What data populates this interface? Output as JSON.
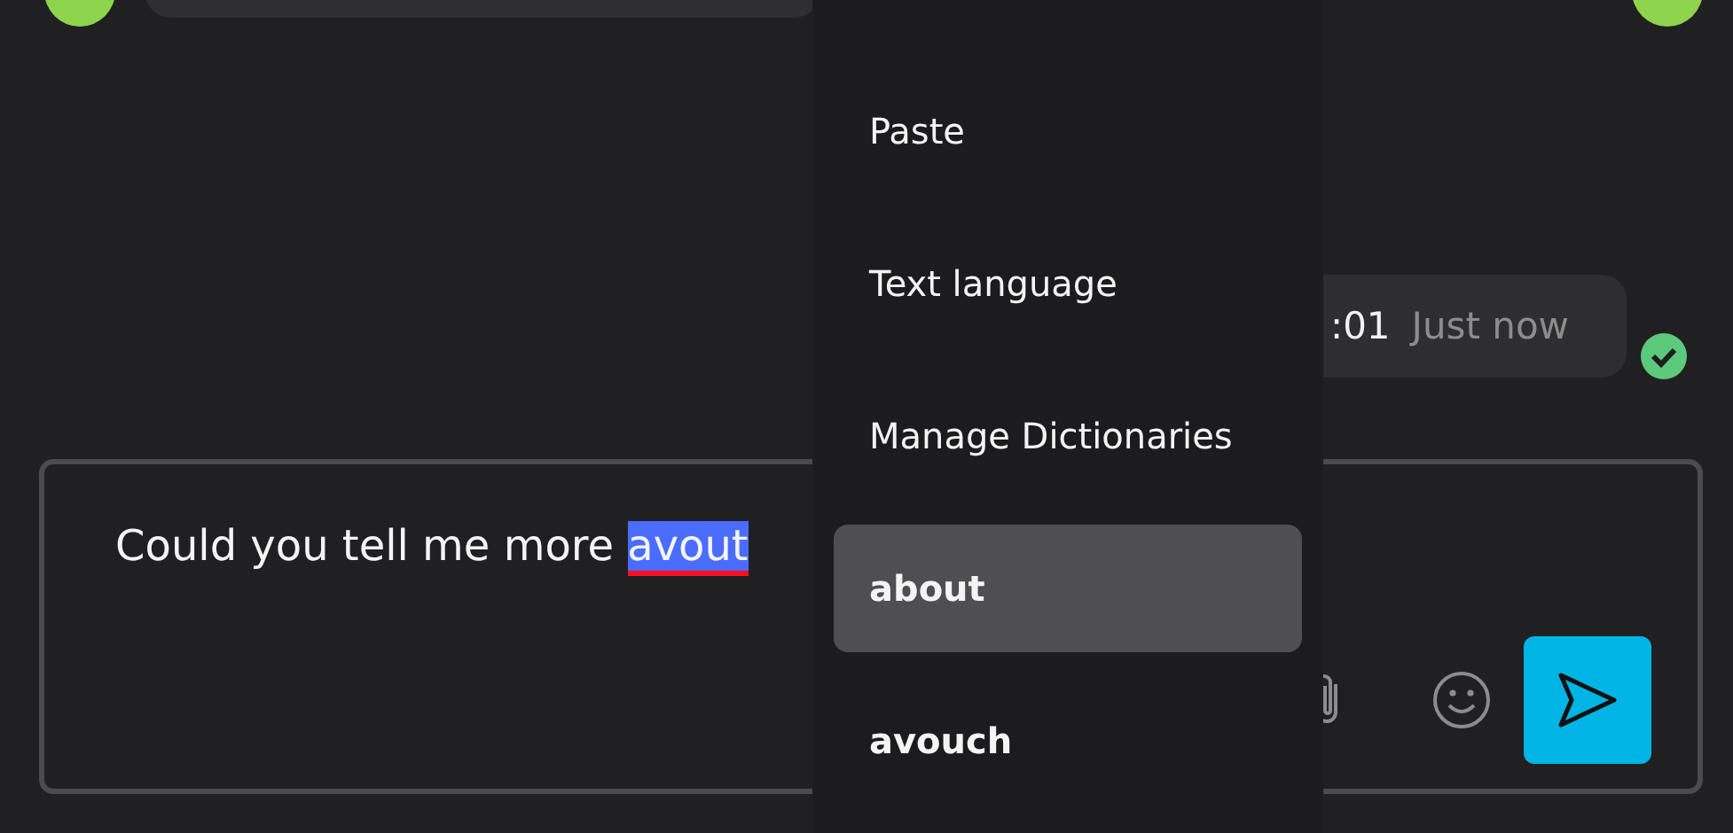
{
  "message": {
    "time": ":01",
    "status": "Just now",
    "delivered": true
  },
  "composer": {
    "text": "Could you tell me more ",
    "misspelled_word": "avout"
  },
  "context_menu": {
    "items": [
      {
        "kind": "action",
        "label": "Paste",
        "selected": false
      },
      {
        "kind": "action",
        "label": "Text language",
        "selected": false
      },
      {
        "kind": "action",
        "label": "Manage Dictionaries",
        "selected": false
      },
      {
        "kind": "suggestion",
        "label": "about",
        "selected": true
      },
      {
        "kind": "suggestion",
        "label": "avouch",
        "selected": false
      }
    ]
  }
}
